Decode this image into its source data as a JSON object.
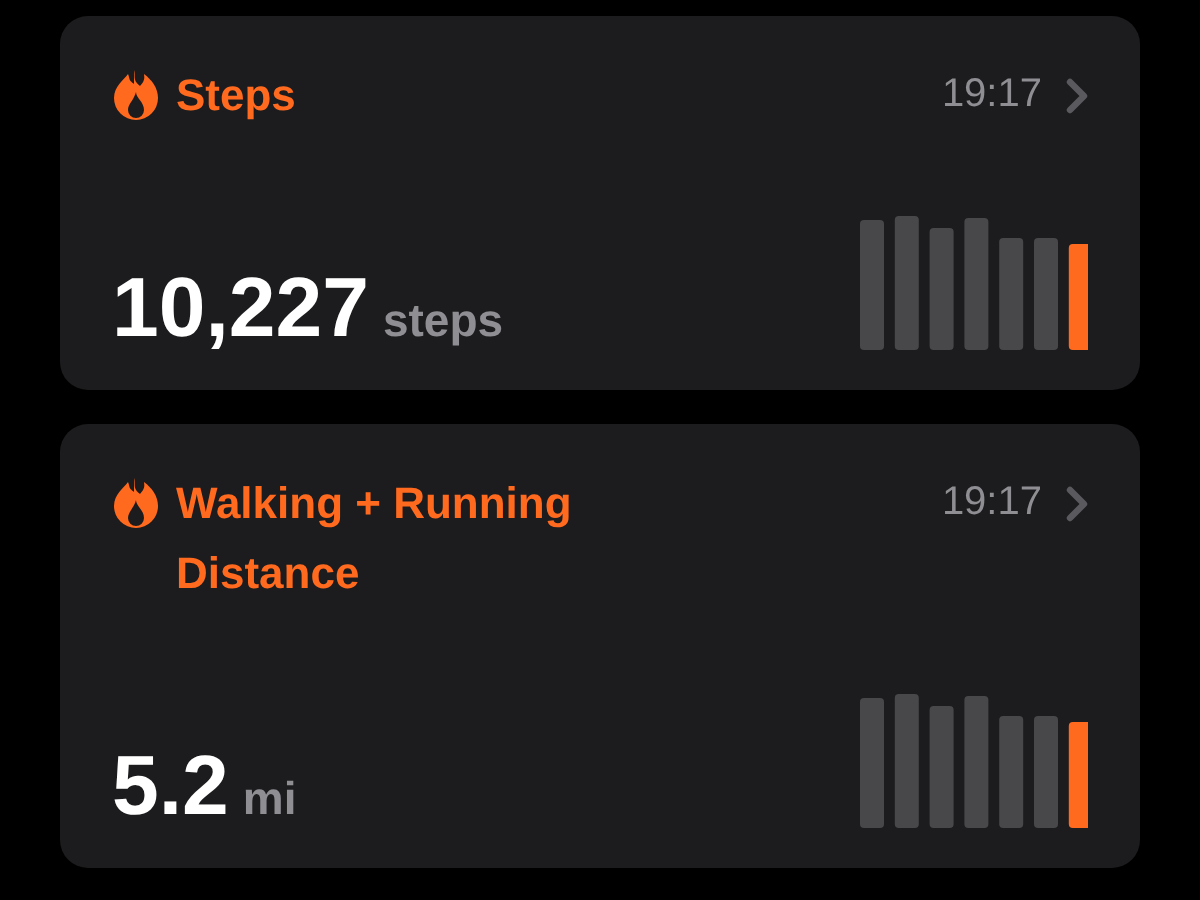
{
  "cards": [
    {
      "title": "Steps",
      "time": "19:17",
      "value": "10,227",
      "unit": "steps"
    },
    {
      "title": "Walking + Running Distance",
      "time": "19:17",
      "value": "5.2",
      "unit": "mi"
    }
  ]
}
